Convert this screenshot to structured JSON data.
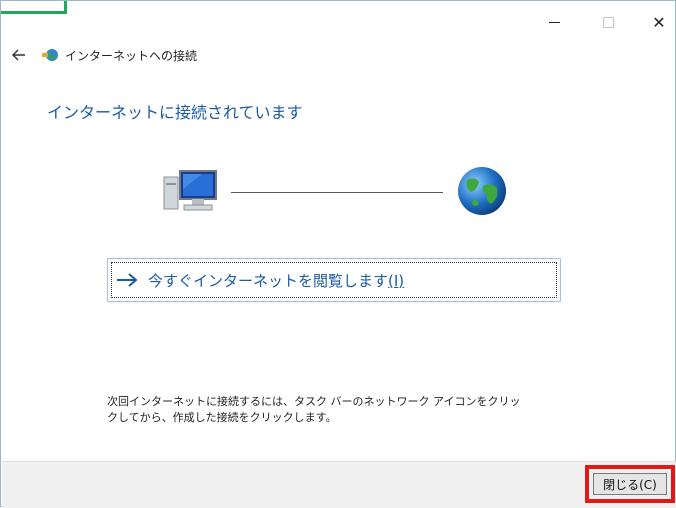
{
  "window": {
    "controls": {
      "minimize": "minimize-icon",
      "maximize": "maximize-icon",
      "close": "close-icon",
      "close_glyph": "✕"
    }
  },
  "nav": {
    "back_icon": "back-arrow-icon",
    "app_icon": "network-globe-icon",
    "title": "インターネットへの接続"
  },
  "main": {
    "heading": "インターネットに接続されています",
    "diagram": {
      "computer_icon": "computer-icon",
      "globe_icon": "globe-icon"
    },
    "browse_link": {
      "icon": "arrow-right-icon",
      "label": "今すぐインターネットを閲覧します",
      "accelerator": "(I)"
    },
    "info_text_line1": "次回インターネットに接続するには、タスク バーのネットワーク アイコンをクリッ",
    "info_text_line2": "クしてから、作成した接続をクリックします。"
  },
  "footer": {
    "close_button": "閉じる(C)"
  },
  "colors": {
    "accent_blue": "#1b5aa8",
    "highlight_red": "#e01818",
    "corner_green": "#23a55a"
  }
}
